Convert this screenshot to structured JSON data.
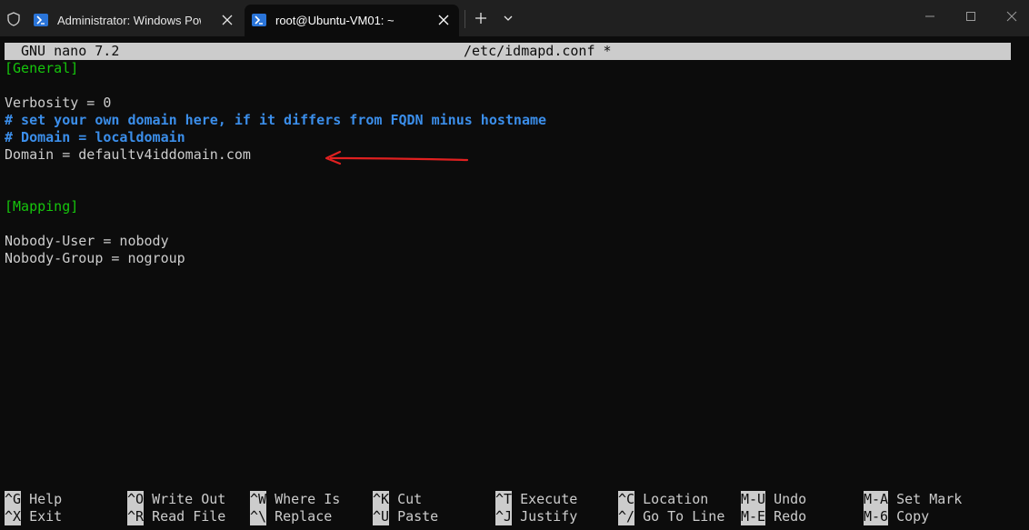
{
  "window": {
    "tabs": [
      {
        "title": "Administrator: Windows PowerShell",
        "active": false,
        "icon": "powershell-icon"
      },
      {
        "title": "root@Ubuntu-VM01: ~",
        "active": true,
        "icon": "powershell-icon"
      }
    ],
    "controls": [
      "shield-icon",
      "new-tab-icon",
      "dropdown-icon",
      "minimize-icon",
      "maximize-icon",
      "close-icon"
    ]
  },
  "editor": {
    "app_version": "GNU nano 7.2",
    "file_name": "/etc/idmapd.conf *",
    "lines": [
      "[General]",
      "",
      "Verbosity = 0",
      "# set your own domain here, if it differs from FQDN minus hostname",
      "# Domain = localdomain",
      "Domain = defaultv4iddomain.com",
      "",
      "",
      "[Mapping]",
      "",
      "Nobody-User = nobody",
      "Nobody-Group = nogroup"
    ],
    "annotation": "red-arrow-pointing-left"
  },
  "shortcuts": [
    [
      {
        "key": "^G",
        "label": "Help"
      },
      {
        "key": "^O",
        "label": "Write Out"
      },
      {
        "key": "^W",
        "label": "Where Is"
      },
      {
        "key": "^K",
        "label": "Cut"
      },
      {
        "key": "^T",
        "label": "Execute"
      },
      {
        "key": "^C",
        "label": "Location"
      },
      {
        "key": "M-U",
        "label": "Undo"
      },
      {
        "key": "M-A",
        "label": "Set Mark"
      }
    ],
    [
      {
        "key": "^X",
        "label": "Exit"
      },
      {
        "key": "^R",
        "label": "Read File"
      },
      {
        "key": "^\\",
        "label": "Replace"
      },
      {
        "key": "^U",
        "label": "Paste"
      },
      {
        "key": "^J",
        "label": "Justify"
      },
      {
        "key": "^/",
        "label": "Go To Line"
      },
      {
        "key": "M-E",
        "label": "Redo"
      },
      {
        "key": "M-6",
        "label": "Copy"
      }
    ]
  ],
  "colors": {
    "terminal_bg": "#0c0c0c",
    "text": "#cccccc",
    "section": "#16c60c",
    "comment": "#3b8eea",
    "arrow": "#e02020",
    "header_bg": "#cccccc"
  }
}
